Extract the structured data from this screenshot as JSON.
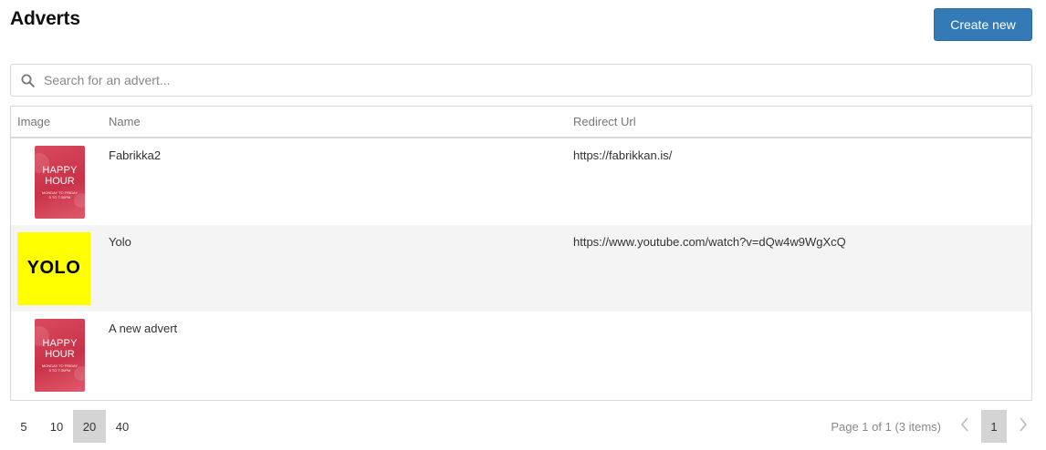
{
  "header": {
    "title": "Adverts",
    "create_label": "Create new"
  },
  "search": {
    "placeholder": "Search for an advert...",
    "value": ""
  },
  "table": {
    "columns": [
      "Image",
      "Name",
      "Redirect Url"
    ],
    "rows": [
      {
        "image": {
          "kind": "happy-hour",
          "line1": "HAPPY",
          "line2": "HOUR",
          "line3": "MONDAY TO FRIDAY",
          "line4": "5 TO 7:30PM"
        },
        "name": "Fabrikka2",
        "url": "https://fabrikkan.is/"
      },
      {
        "image": {
          "kind": "yolo",
          "text": "YOLO"
        },
        "name": "Yolo",
        "url": "https://www.youtube.com/watch?v=dQw4w9WgXcQ"
      },
      {
        "image": {
          "kind": "happy-hour",
          "line1": "HAPPY",
          "line2": "HOUR",
          "line3": "MONDAY TO FRIDAY",
          "line4": "5 TO 7:30PM"
        },
        "name": "A new advert",
        "url": ""
      }
    ]
  },
  "pager": {
    "sizes": [
      "5",
      "10",
      "20",
      "40"
    ],
    "selected_size": "20",
    "info": "Page 1 of 1 (3 items)",
    "current_page": "1",
    "prev_icon": "chevron-left-icon",
    "next_icon": "chevron-right-icon"
  },
  "colors": {
    "accent": "#337ab7",
    "selected_bg": "#d4d4d4",
    "row_alt": "#f4f4f4",
    "happy_hour": "#cc3b50",
    "yolo": "#ffff00"
  }
}
